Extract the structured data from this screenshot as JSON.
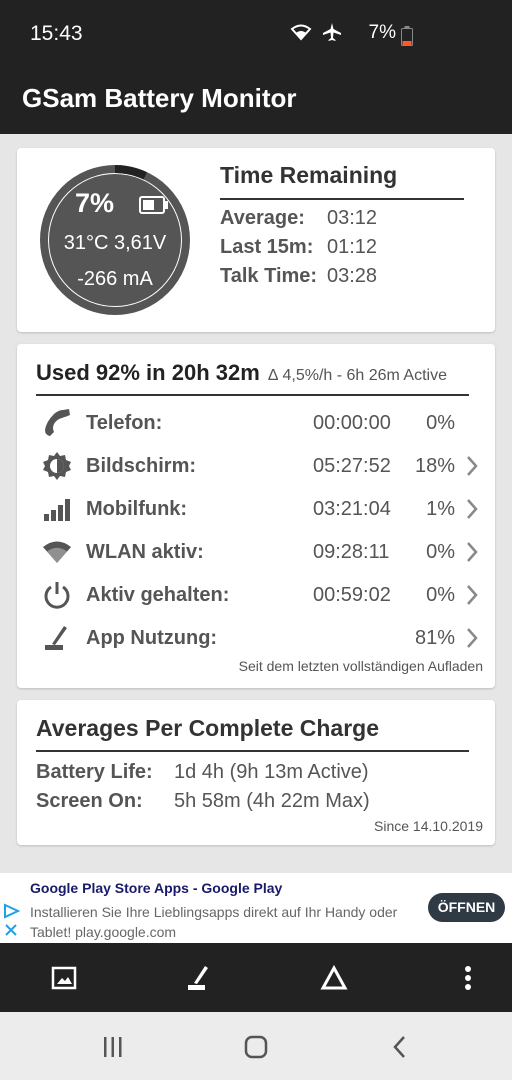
{
  "status_bar": {
    "time": "15:43",
    "battery_pct": "7%",
    "icons": [
      "wifi-icon",
      "airplane-mode-icon",
      "battery-low-icon"
    ]
  },
  "app_bar": {
    "title": "GSam Battery Monitor"
  },
  "gauge": {
    "level_fraction": 0.07,
    "percent_text": "7%",
    "temp_voltage": "31°C  3,61V",
    "current": "-266 mA",
    "colors": {
      "ring": "#555555",
      "fill": "#222222",
      "face": "#555555"
    }
  },
  "time_remaining": {
    "title": "Time Remaining",
    "rows": [
      {
        "label": "Average:",
        "value": "03:12"
      },
      {
        "label": "Last 15m:",
        "value": "01:12"
      },
      {
        "label": "Talk Time:",
        "value": "03:28"
      }
    ]
  },
  "usage": {
    "headline": "Used 92% in 20h 32m",
    "rate": "∆ 4,5%/h - 6h 26m Active",
    "rows": [
      {
        "icon": "phone-icon",
        "label": "Telefon:",
        "time": "00:00:00",
        "pct": "0%",
        "chevron": false
      },
      {
        "icon": "brightness-icon",
        "label": "Bildschirm:",
        "time": "05:27:52",
        "pct": "18%",
        "chevron": true
      },
      {
        "icon": "signal-bars-icon",
        "label": "Mobilfunk:",
        "time": "03:21:04",
        "pct": "1%",
        "chevron": true
      },
      {
        "icon": "wifi-icon",
        "label": "WLAN aktiv:",
        "time": "09:28:11",
        "pct": "0%",
        "chevron": true
      },
      {
        "icon": "power-icon",
        "label": "Aktiv gehalten:",
        "time": "00:59:02",
        "pct": "0%",
        "chevron": true
      },
      {
        "icon": "app-usage-icon",
        "label": "App Nutzung:",
        "time": "",
        "pct": "81%",
        "chevron": true
      }
    ],
    "footer": "Seit dem letzten vollständigen Aufladen"
  },
  "averages": {
    "title": "Averages Per Complete Charge",
    "rows": [
      {
        "label": "Battery Life:",
        "value": "1d 4h (9h 13m Active)"
      },
      {
        "label": "Screen On:",
        "value": "5h 58m (4h 22m Max)"
      }
    ],
    "footer": "Since 14.10.2019"
  },
  "ad": {
    "title": "Google Play Store Apps - Google Play",
    "body": "Installieren Sie Ihre Lieblingsapps direkt auf Ihr Handy oder Tablet! play.google.com",
    "button": "ÖFFNEN"
  },
  "toolbar": {
    "icons": [
      "image-icon",
      "app-usage-icon",
      "delta-icon",
      "overflow-menu-icon"
    ]
  },
  "nav": {
    "icons": [
      "recents-icon",
      "home-icon",
      "back-icon"
    ]
  }
}
